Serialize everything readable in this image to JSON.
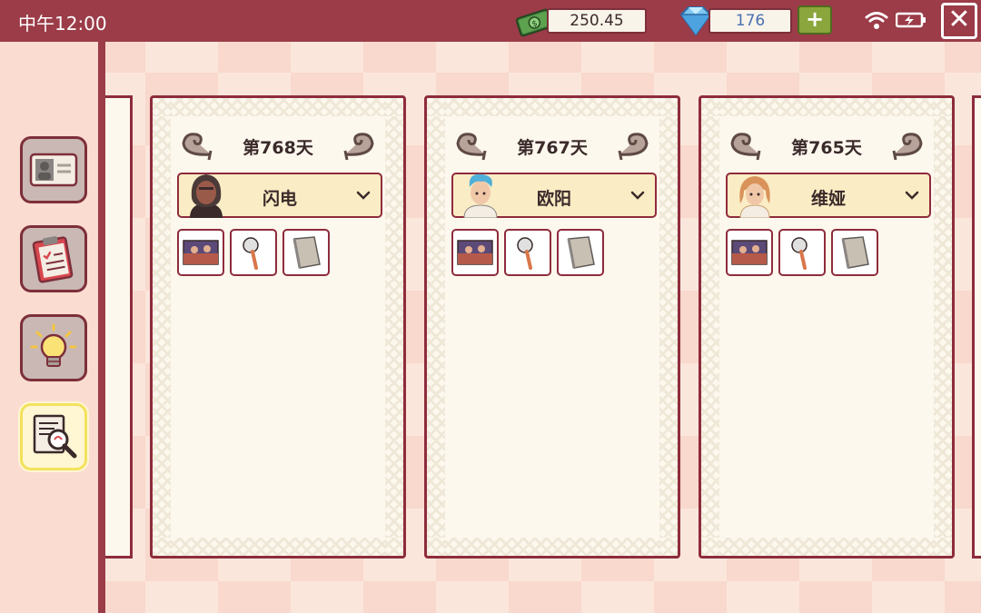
{
  "status_bar": {
    "time": "中午12:00",
    "money": "250.45",
    "gems": "176",
    "add_label": "+",
    "close_label": "✕"
  },
  "sidebar": {
    "items": [
      {
        "name": "id-card",
        "icon": "id-card-icon",
        "active": false
      },
      {
        "name": "clipboard",
        "icon": "clipboard-icon",
        "active": false
      },
      {
        "name": "lightbulb",
        "icon": "lightbulb-icon",
        "active": false
      },
      {
        "name": "case-search",
        "icon": "magnifier-document-icon",
        "active": true
      }
    ]
  },
  "cards": [
    {
      "day": "第768天",
      "character": "闪电",
      "evidence": [
        "photo",
        "pizza-cutter",
        "book"
      ]
    },
    {
      "day": "第767天",
      "character": "欧阳",
      "evidence": [
        "photo",
        "pizza-cutter",
        "book"
      ]
    },
    {
      "day": "第765天",
      "character": "维娅",
      "evidence": [
        "photo",
        "pizza-cutter",
        "book"
      ]
    }
  ],
  "colors": {
    "topbar": "#9b3c48",
    "card_border": "#8e2c3c",
    "card_bg": "#fdf8ee",
    "select_bg": "#faecc4",
    "accent_green": "#8aa63c",
    "active_highlight": "#f3e15d"
  }
}
